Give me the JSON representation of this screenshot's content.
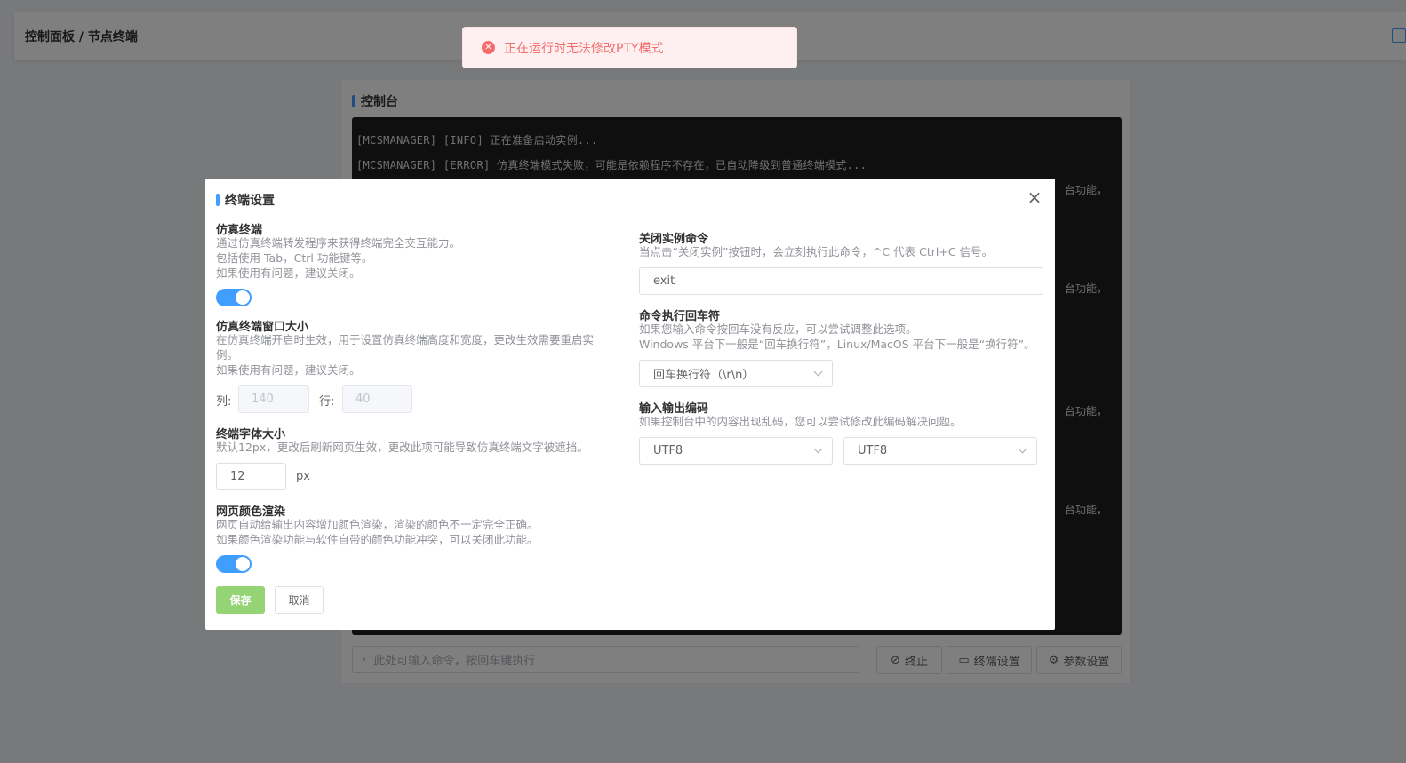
{
  "header": {
    "breadcrumb": "控制面板 / 节点终端"
  },
  "toast": {
    "message": "正在运行时无法修改PTY模式",
    "icon": "error-icon",
    "color": "#f56c6c"
  },
  "console": {
    "title": "控制台",
    "lines": [
      "[MCSMANAGER] [INFO] 正在准备启动实例...",
      "[MCSMANAGER] [ERROR] 仿真终端模式失败，可能是依赖程序不存在，已自动降级到普通终端模式..."
    ],
    "line_tail": "台功能，",
    "command_placeholder": "此处可输入命令，按回车键执行",
    "buttons": {
      "stop": "终止",
      "terminal_settings": "终端设置",
      "params_settings": "参数设置"
    }
  },
  "dialog": {
    "title": "终端设置",
    "pty": {
      "title": "仿真终端",
      "desc": [
        "通过仿真终端转发程序来获得终端完全交互能力。",
        "包括使用 Tab，Ctrl 功能键等。",
        "如果使用有问题，建议关闭。"
      ],
      "enabled": true
    },
    "pty_size": {
      "title": "仿真终端窗口大小",
      "desc": [
        "在仿真终端开启时生效，用于设置仿真终端高度和宽度，更改生效需要重启实",
        "例。",
        "如果使用有问题，建议关闭。"
      ],
      "cols_label": "列:",
      "cols_value": "140",
      "rows_label": "行:",
      "rows_value": "40"
    },
    "font_size": {
      "title": "终端字体大小",
      "desc": "默认12px，更改后刷新网页生效，更改此项可能导致仿真终端文字被遮挡。",
      "value": "12",
      "unit": "px"
    },
    "color_render": {
      "title": "网页颜色渲染",
      "desc": [
        "网页自动给输出内容增加颜色渲染，渲染的颜色不一定完全正确。",
        "如果颜色渲染功能与软件自带的颜色功能冲突，可以关闭此功能。"
      ],
      "enabled": true
    },
    "stop_command": {
      "title": "关闭实例命令",
      "desc": "当点击“关闭实例”按钮时，会立刻执行此命令，^C 代表 Ctrl+C 信号。",
      "value": "exit"
    },
    "line_ending": {
      "title": "命令执行回车符",
      "desc": [
        "如果您输入命令按回车没有反应，可以尝试调整此选项。",
        "Windows 平台下一般是“回车换行符”，Linux/MacOS 平台下一般是“换行符”。"
      ],
      "selected": "回车换行符（\\r\\n）"
    },
    "encoding": {
      "title": "输入输出编码",
      "desc": "如果控制台中的内容出现乱码，您可以尝试修改此编码解决问题。",
      "input": "UTF8",
      "output": "UTF8"
    },
    "save_label": "保存",
    "cancel_label": "取消"
  },
  "colors": {
    "accent": "#409eff",
    "save": "#95d475",
    "error": "#f56c6c"
  }
}
